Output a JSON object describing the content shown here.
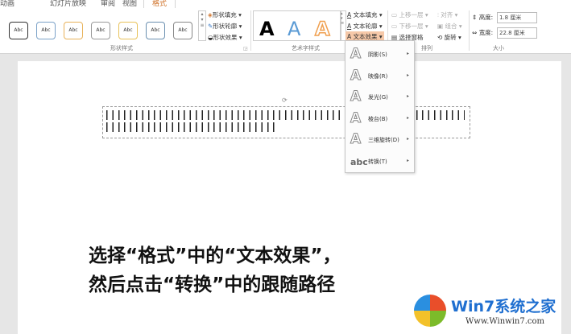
{
  "tabs": [
    "动画",
    "幻灯片放映",
    "审阅",
    "视图",
    "格式"
  ],
  "shape_styles": {
    "sample": "Abc",
    "colors": [
      "#333333",
      "#7ba2c8",
      "#e8b25a",
      "#999999",
      "#e8c25a",
      "#6a8fb0",
      "#888888"
    ],
    "fill": "形状填充",
    "outline": "形状轮廓",
    "effects": "形状效果",
    "group": "形状样式"
  },
  "wordart": {
    "sample": "A",
    "text_fill": "文本填充",
    "text_outline": "文本轮廓",
    "text_effects": "文本效果",
    "group": "艺术字样式"
  },
  "arrange": {
    "bring_forward": "上移一层",
    "send_backward": "下移一层",
    "selection_pane": "选择窗格",
    "align": "对齐",
    "group_cmd": "组合",
    "rotate": "旋转",
    "group": "排列"
  },
  "size": {
    "height_label": "高度:",
    "height_value": "1.8 厘米",
    "width_label": "宽度:",
    "width_value": "22.8 厘米",
    "group": "大小"
  },
  "menu": [
    {
      "label": "阴影(S)",
      "icon": "A"
    },
    {
      "label": "映像(R)",
      "icon": "A"
    },
    {
      "label": "发光(G)",
      "icon": "A"
    },
    {
      "label": "棱台(B)",
      "icon": "A"
    },
    {
      "label": "三维旋转(D)",
      "icon": "A"
    },
    {
      "label": "转换(T)",
      "icon": "abc"
    }
  ],
  "instructions": [
    "选择“格式”中的“文本效果”，",
    "然后点击“转换”中的跟随路径"
  ],
  "watermark": {
    "brand": "Win7系统之家",
    "url": "Www.Winwin7.com"
  }
}
